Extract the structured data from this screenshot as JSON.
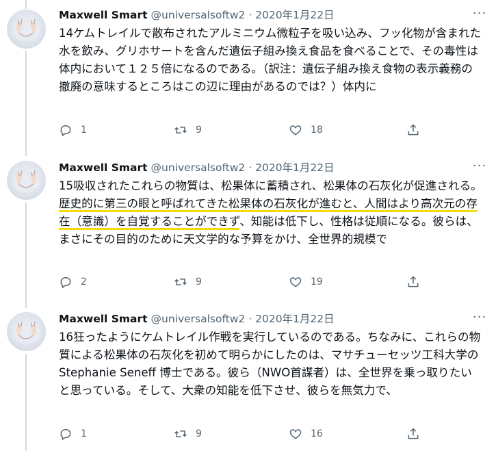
{
  "tweets": [
    {
      "name": "Maxwell Smart",
      "handle": "@universalsoftw2",
      "date": "2020年1月22日",
      "text": [
        {
          "t": "14ケムトレイルで散布されたアルミニウム微粒子を吸い込み、フッ化物が含まれた水を飲み、グリホサートを含んだ遺伝子組み換え食品を食べることで、その毒性は体内において１２５倍になるのである。（訳注：遺伝子組み換え食物の表示義務の撤廃の意味するところはこの辺に理由があるのでは？）体内に",
          "hl": false
        }
      ],
      "replies": "1",
      "retweets": "9",
      "likes": "18"
    },
    {
      "name": "Maxwell Smart",
      "handle": "@universalsoftw2",
      "date": "2020年1月22日",
      "text": [
        {
          "t": "15吸収されたこれらの物質は、松果体に蓄積され、松果体の石灰化が促進される。",
          "hl": false
        },
        {
          "t": "歴史的に第三の眼と呼ばれてきた松果体の石灰化が進むと、人間はより高次元の存在（意識）を自覚することができず",
          "hl": true
        },
        {
          "t": "、知能は低下し、性格は従順になる。彼らは、まさにその目的のために天文学的な予算をかけ、全世界的規模で",
          "hl": false
        }
      ],
      "replies": "2",
      "retweets": "9",
      "likes": "19"
    },
    {
      "name": "Maxwell Smart",
      "handle": "@universalsoftw2",
      "date": "2020年1月22日",
      "text": [
        {
          "t": "16狂ったようにケムトレイル作戦を実行しているのである。ちなみに、これらの物質による松果体の石灰化を初めて明らかにしたのは、マサチューセッツ工科大学のStephanie Seneff 博士である。彼ら（NWO首謀者）は、全世界を乗っ取りたいと思っている。そして、大衆の知能を低下させ、彼らを無気力で、",
          "hl": false
        }
      ],
      "replies": "1",
      "retweets": "9",
      "likes": "16"
    }
  ],
  "colors": {
    "text": "#0f1419",
    "muted": "#536471",
    "highlight": "#f5d90a",
    "thread": "#cfd9de"
  },
  "icons": {
    "reply": "reply-icon",
    "retweet": "retweet-icon",
    "like": "heart-icon",
    "share": "share-icon",
    "more": "more-icon"
  }
}
